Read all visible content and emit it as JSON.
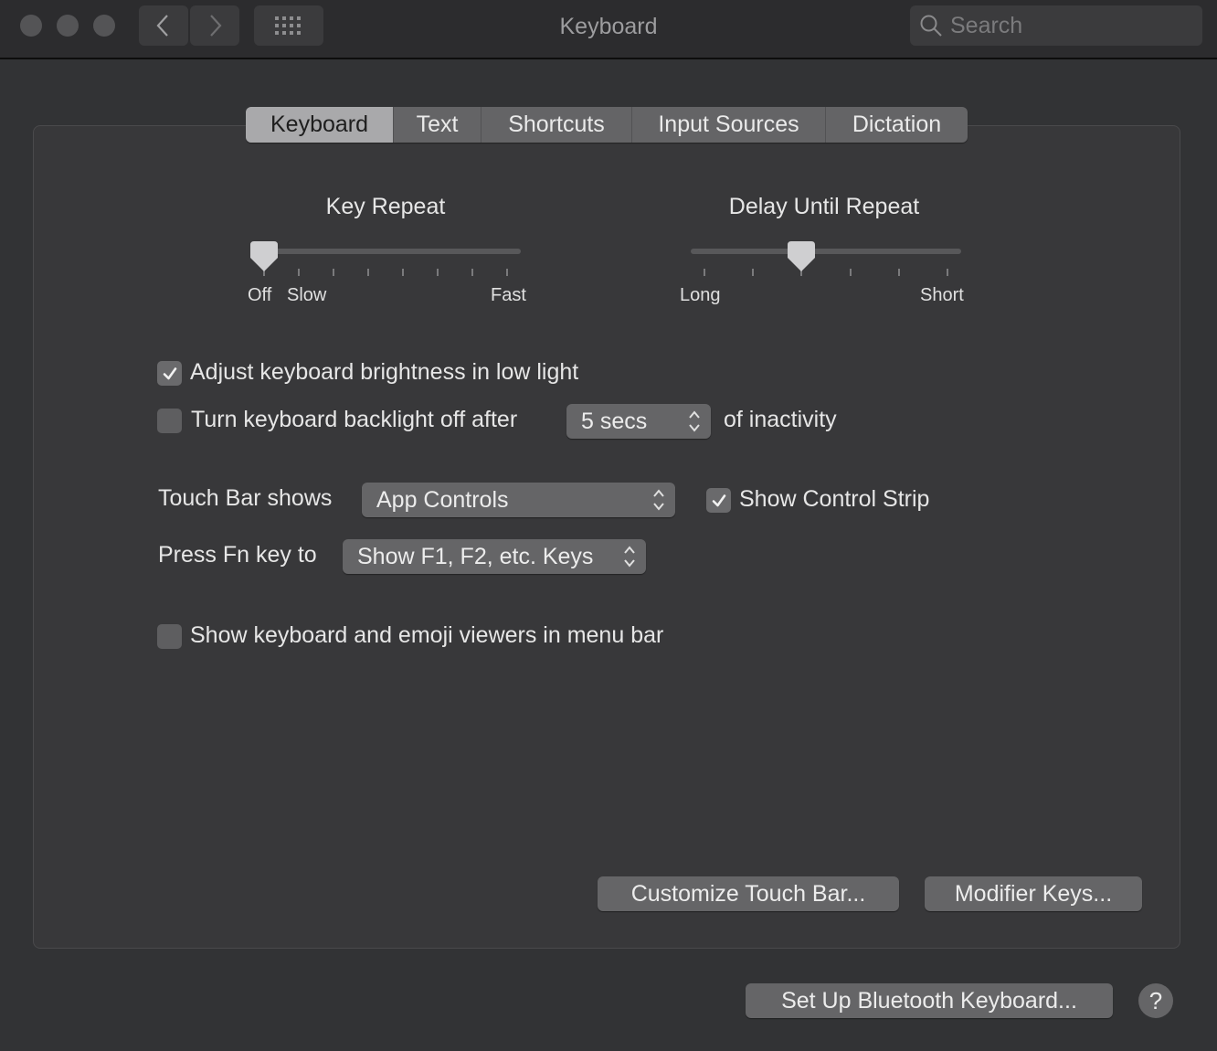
{
  "window": {
    "title": "Keyboard",
    "search_placeholder": "Search"
  },
  "tabs": [
    {
      "label": "Keyboard",
      "active": true
    },
    {
      "label": "Text",
      "active": false
    },
    {
      "label": "Shortcuts",
      "active": false
    },
    {
      "label": "Input Sources",
      "active": false
    },
    {
      "label": "Dictation",
      "active": false
    }
  ],
  "key_repeat": {
    "title": "Key Repeat",
    "tick_count": 8,
    "value_index": 0,
    "labels": {
      "off": "Off",
      "min": "Slow",
      "max": "Fast"
    }
  },
  "delay_until_repeat": {
    "title": "Delay Until Repeat",
    "tick_count": 6,
    "value_index": 2,
    "labels": {
      "min": "Long",
      "max": "Short"
    }
  },
  "options": {
    "adjust_brightness": {
      "label": "Adjust keyboard brightness in low light",
      "checked": true
    },
    "backlight_off": {
      "label": "Turn keyboard backlight off after",
      "checked": false,
      "value": "5 secs",
      "suffix": "of inactivity"
    },
    "touch_bar": {
      "label": "Touch Bar shows",
      "value": "App Controls"
    },
    "control_strip": {
      "label": "Show Control Strip",
      "checked": true
    },
    "fn_key": {
      "label": "Press Fn key to",
      "value": "Show F1, F2, etc. Keys"
    },
    "emoji_viewers": {
      "label": "Show keyboard and emoji viewers in menu bar",
      "checked": false
    }
  },
  "buttons": {
    "customize_touch_bar": "Customize Touch Bar...",
    "modifier_keys": "Modifier Keys...",
    "bluetooth": "Set Up Bluetooth Keyboard...",
    "help": "?"
  }
}
